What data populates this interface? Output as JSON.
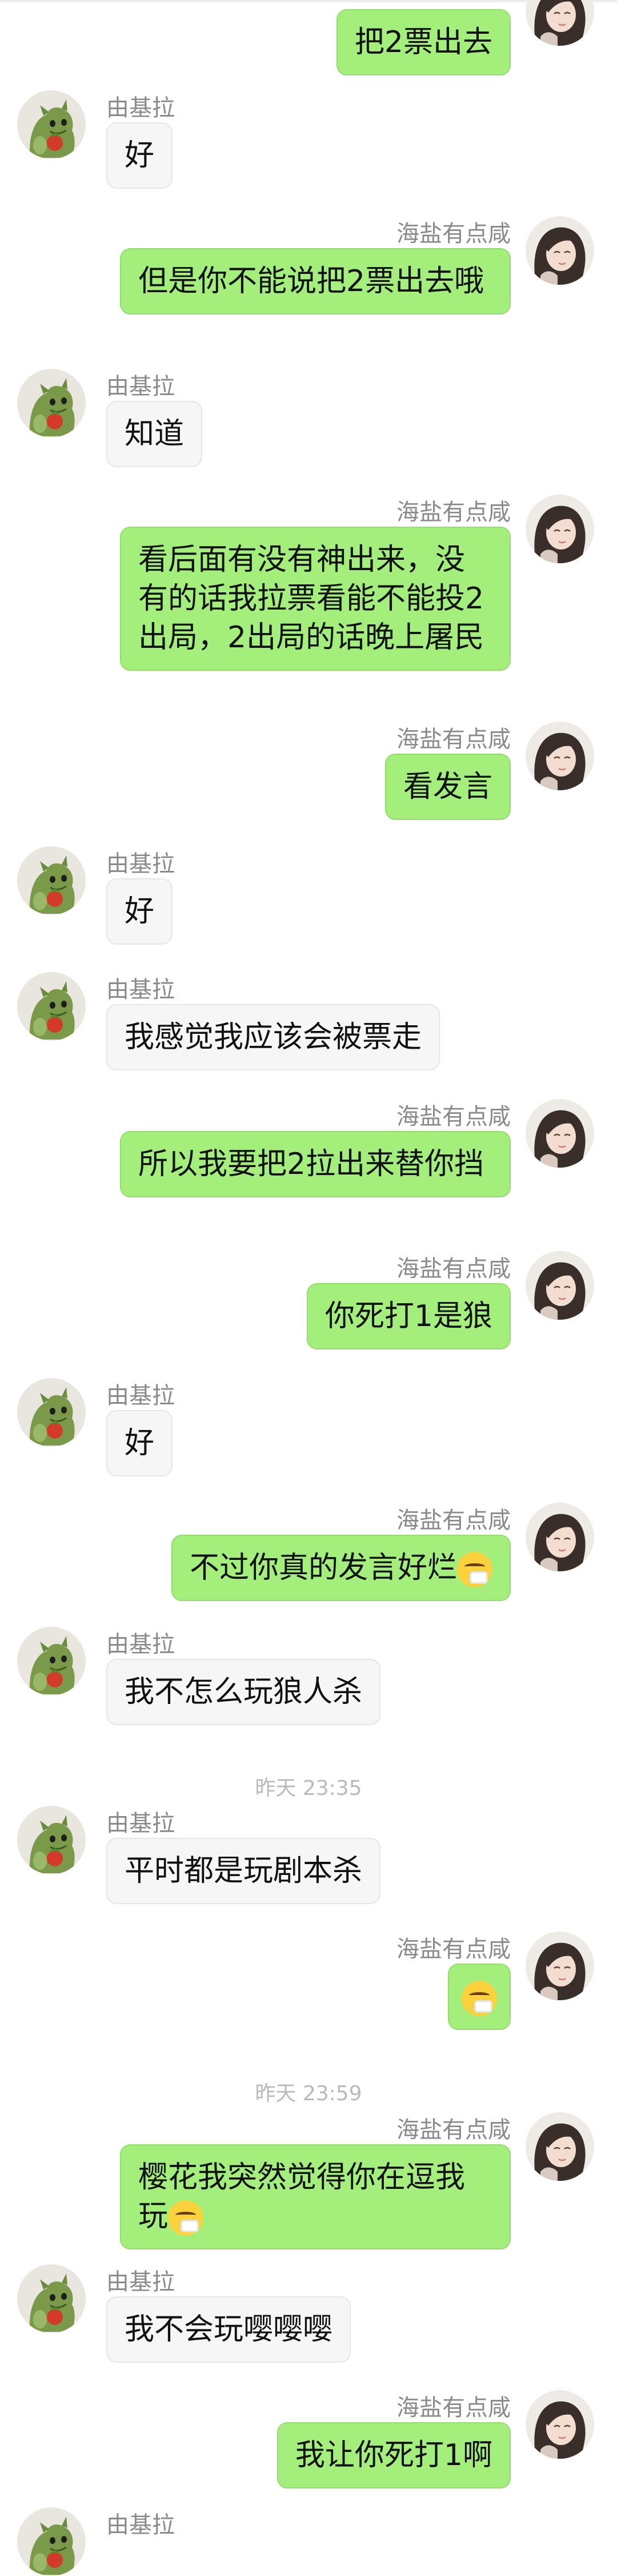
{
  "people": {
    "other": "由基拉",
    "me": "海盐有点咸"
  },
  "messages": [
    {
      "side": "right",
      "text": "把2票出去"
    },
    {
      "side": "left",
      "name": "由基拉",
      "text": "好"
    },
    {
      "side": "right",
      "name": "海盐有点咸",
      "text": "但是你不能说把2票出去哦"
    },
    {
      "side": "left",
      "name": "由基拉",
      "text": "知道"
    },
    {
      "side": "right",
      "name": "海盐有点咸",
      "text": "看后面有没有神出来，没有的话我拉票看能不能投2出局，2出局的话晚上屠民"
    },
    {
      "side": "right",
      "name": "海盐有点咸",
      "text": "看发言"
    },
    {
      "side": "left",
      "name": "由基拉",
      "text": "好"
    },
    {
      "side": "left",
      "name": "由基拉",
      "text": "我感觉我应该会被票走"
    },
    {
      "side": "right",
      "name": "海盐有点咸",
      "text": "所以我要把2拉出来替你挡"
    },
    {
      "side": "right",
      "name": "海盐有点咸",
      "text": "你死打1是狼"
    },
    {
      "side": "left",
      "name": "由基拉",
      "text": "好"
    },
    {
      "side": "right",
      "name": "海盐有点咸",
      "text": "不过你真的发言好烂",
      "emoji": "sneezing-face-emoji"
    },
    {
      "side": "left",
      "name": "由基拉",
      "text": "我不怎么玩狼人杀"
    },
    {
      "side": "left",
      "name": "由基拉",
      "text": "平时都是玩剧本杀"
    },
    {
      "side": "right",
      "name": "海盐有点咸",
      "text": "",
      "emoji": "sneezing-face-emoji"
    },
    {
      "side": "right",
      "name": "海盐有点咸",
      "text": "樱花我突然觉得你在逗我玩",
      "emoji": "sneezing-face-emoji"
    },
    {
      "side": "left",
      "name": "由基拉",
      "text": "我不会玩嘤嘤嘤"
    },
    {
      "side": "right",
      "name": "海盐有点咸",
      "text": "我让你死打1啊"
    }
  ],
  "timestamps": [
    "昨天 23:35",
    "昨天 23:59"
  ],
  "colors": {
    "sent_bubble": "#a4ee7c",
    "received_bubble": "#f6f6f6",
    "name_text": "#8a8a8a",
    "timestamp_text": "#b9b9b9"
  }
}
